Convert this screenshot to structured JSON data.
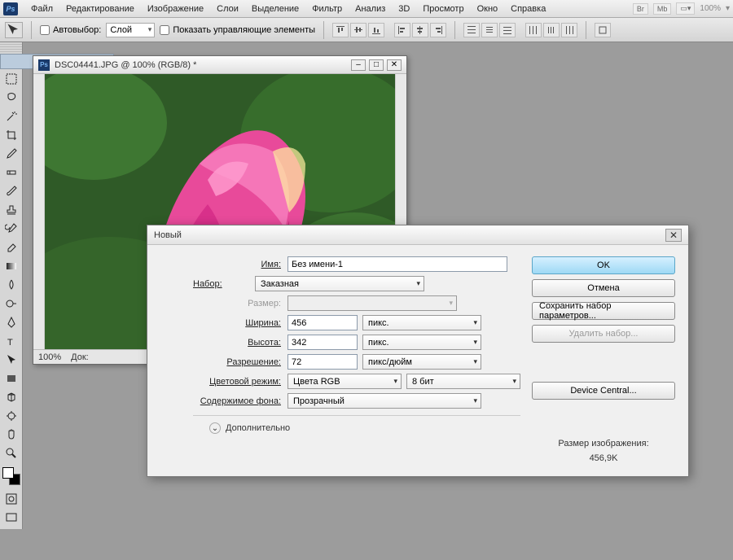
{
  "app": {
    "logo": "Ps"
  },
  "menubar": {
    "items": [
      "Файл",
      "Редактирование",
      "Изображение",
      "Слои",
      "Выделение",
      "Фильтр",
      "Анализ",
      "3D",
      "Просмотр",
      "Окно",
      "Справка"
    ],
    "zoom": "100%"
  },
  "optionsbar": {
    "autoselect_label": "Автовыбор:",
    "autoselect_value": "Слой",
    "show_controls_label": "Показать управляющие элементы"
  },
  "toolbox": {
    "tools": [
      "move",
      "marquee",
      "lasso",
      "wand",
      "crop",
      "eyedropper",
      "heal",
      "brush",
      "stamp",
      "history-brush",
      "eraser",
      "gradient",
      "blur",
      "dodge",
      "pen",
      "type",
      "path-select",
      "rectangle",
      "hand",
      "zoom"
    ]
  },
  "document": {
    "title": "DSC04441.JPG @ 100% (RGB/8) *",
    "status_zoom": "100%",
    "status_doc": "Док:"
  },
  "dialog": {
    "title": "Новый",
    "labels": {
      "name": "Имя:",
      "preset": "Набор:",
      "size": "Размер:",
      "width": "Ширина:",
      "height": "Высота:",
      "resolution": "Разрешение:",
      "color_mode": "Цветовой режим:",
      "bg_contents": "Содержимое фона:",
      "advanced": "Дополнительно"
    },
    "values": {
      "name": "Без имени-1",
      "preset": "Заказная",
      "size": "",
      "width": "456",
      "width_unit": "пикс.",
      "height": "342",
      "height_unit": "пикс.",
      "resolution": "72",
      "resolution_unit": "пикс/дюйм",
      "color_mode": "Цвета RGB",
      "color_depth": "8 бит",
      "bg_contents": "Прозрачный"
    },
    "buttons": {
      "ok": "OK",
      "cancel": "Отмена",
      "save_preset": "Сохранить набор параметров...",
      "delete_preset": "Удалить набор...",
      "device_central": "Device Central..."
    },
    "info": {
      "size_label": "Размер изображения:",
      "size_value": "456,9K"
    }
  }
}
